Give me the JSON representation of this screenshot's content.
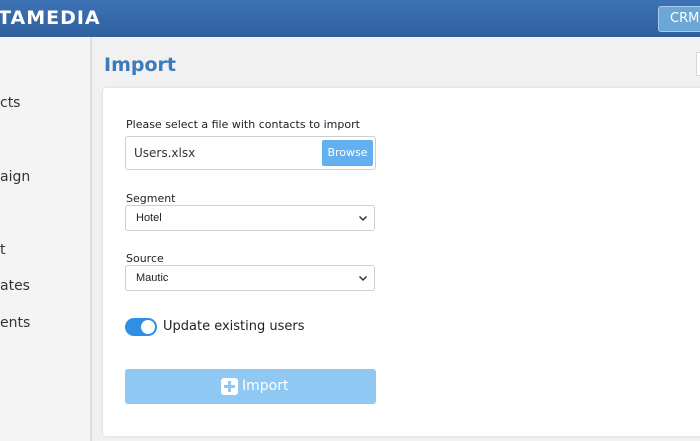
{
  "header": {
    "brand": "TAMEDIA",
    "crm_label": "CRM"
  },
  "sidebar": {
    "items": [
      {
        "label": "cts"
      },
      {
        "label": "aign"
      },
      {
        "label": "t"
      },
      {
        "label": "ates"
      },
      {
        "label": "ents"
      }
    ]
  },
  "page": {
    "title": "Import"
  },
  "form": {
    "file_label": "Please select a file with contacts to import",
    "file_value": "Users.xlsx",
    "browse_label": "Browse",
    "segment_label": "Segment",
    "segment_value": "Hotel",
    "source_label": "Source",
    "source_value": "Mautic",
    "update_label": "Update existing users",
    "update_enabled": true,
    "import_label": "Import"
  },
  "colors": {
    "header": "#3d73b6",
    "title": "#3e7ab8",
    "browse": "#62b0ef",
    "toggle": "#2f8ee6",
    "import_button": "#8ec8f3"
  },
  "icons": {
    "select_arrow": "chevron-down-icon",
    "import": "plus-icon"
  }
}
